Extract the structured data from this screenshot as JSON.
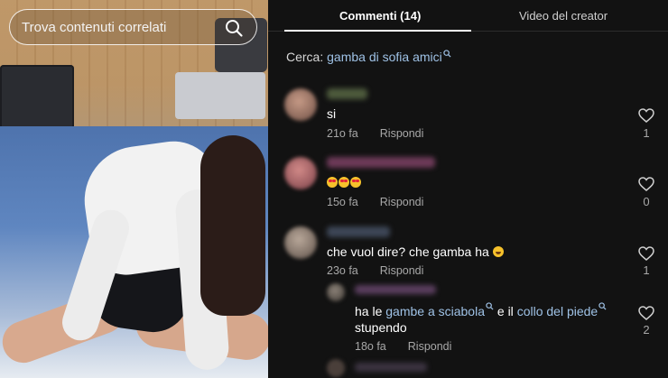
{
  "video": {
    "search_placeholder": "Trova contenuti correlati",
    "search_icon": "search-icon"
  },
  "tabs": {
    "comments": "Commenti (14)",
    "creator_videos": "Video del creator",
    "active": "comments"
  },
  "search_suggestion": {
    "label": "Cerca:",
    "term": "gamba di sofia amici"
  },
  "colors": {
    "background": "#121212",
    "link": "#9fc2e6",
    "muted": "#a8a8a8"
  },
  "comments": [
    {
      "text": "si",
      "time": "21o fa",
      "reply_label": "Rispondi",
      "likes": "1"
    },
    {
      "emoji": [
        "heart-eyes",
        "heart-eyes",
        "heart-eyes"
      ],
      "time": "15o fa",
      "reply_label": "Rispondi",
      "likes": "0"
    },
    {
      "text": "che vuol dire? che gamba ha",
      "emoji": [
        "tears-of-joy"
      ],
      "time": "23o fa",
      "reply_label": "Rispondi",
      "likes": "1"
    }
  ],
  "reply": {
    "text_before": "ha le ",
    "tag1": "gambe a sciabola",
    "text_middle": " e il ",
    "tag2": "collo del piede",
    "line2": "stupendo",
    "time": "18o fa",
    "reply_label": "Rispondi",
    "likes": "2"
  }
}
